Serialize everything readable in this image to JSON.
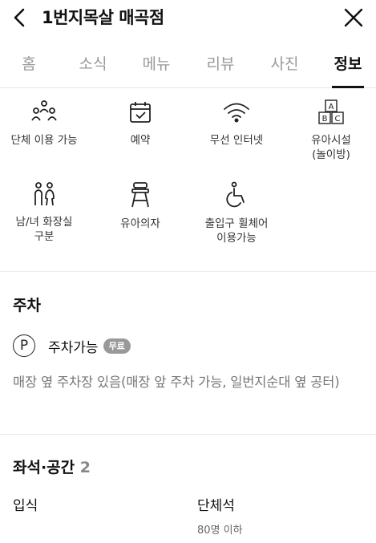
{
  "header": {
    "title": "1번지목살 매곡점"
  },
  "tabs": [
    {
      "label": "홈",
      "active": false
    },
    {
      "label": "소식",
      "active": false
    },
    {
      "label": "메뉴",
      "active": false
    },
    {
      "label": "리뷰",
      "active": false
    },
    {
      "label": "사진",
      "active": false
    },
    {
      "label": "정보",
      "active": true
    }
  ],
  "amenities": [
    {
      "icon": "group-icon",
      "label": "단체 이용 가능"
    },
    {
      "icon": "calendar-check-icon",
      "label": "예약"
    },
    {
      "icon": "wifi-icon",
      "label": "무선 인터넷"
    },
    {
      "icon": "abc-blocks-icon",
      "label": "유아시설\n(놀이방)"
    },
    {
      "icon": "restroom-icon",
      "label": "남/녀 화장실\n구분"
    },
    {
      "icon": "high-chair-icon",
      "label": "유아의자"
    },
    {
      "icon": "wheelchair-icon",
      "label": "출입구 휠체어\n이용가능"
    }
  ],
  "parking": {
    "title": "주차",
    "icon_letter": "P",
    "label": "주차가능",
    "badge": "무료",
    "description": "매장 옆 주차장 있음(매장 앞 주차 가능, 일번지순대 옆 공터)"
  },
  "seating": {
    "title": "좌석·공간",
    "count": "2",
    "items": [
      {
        "name": "입식",
        "sub": ""
      },
      {
        "name": "단체석",
        "sub": "80명 이하"
      }
    ]
  }
}
